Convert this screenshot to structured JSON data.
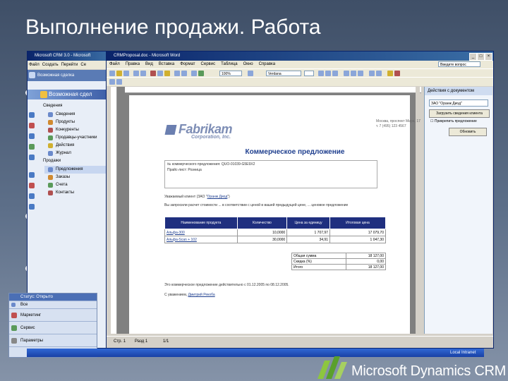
{
  "slide": {
    "title": "Выполнение продажи. Работа",
    "brand": "Microsoft Dynamics CRM"
  },
  "crm_window": {
    "title": "Microsoft CRM 3.0 - Microsoft",
    "menu": [
      "Файл",
      "Создать",
      "Перейти",
      "Се"
    ],
    "entity_header": "Возможная сделка",
    "header_strip": "Возможная сдел",
    "nav_group_details": "Сведения",
    "nav_details": [
      "Сведения",
      "Продукты",
      "Конкуренты",
      "Продавцы-участники",
      "Действия",
      "Журнал"
    ],
    "nav_group_sales": "Продажи",
    "nav_sales": [
      "Предложения",
      "Заказы",
      "Счета",
      "Контакты"
    ],
    "status": "Статус: Открыто",
    "bottom_nav": [
      "Все",
      "Маркетинг",
      "Сервис",
      "Параметры"
    ]
  },
  "word_window": {
    "title": "CRMProposal.doc - Microsoft Word",
    "menu": [
      "Файл",
      "Правка",
      "Вид",
      "Вставка",
      "Формат",
      "Сервис",
      "Таблица",
      "Окно",
      "Справка"
    ],
    "help_box": "Введите вопрос",
    "zoom": "100%",
    "font": "Verdana",
    "status": {
      "page": "Стр. 1",
      "section": "Разд 1",
      "pages": "1/1"
    }
  },
  "document": {
    "company": "Fabrikam",
    "company_sub": "Corporation, Inc.",
    "address": "Москва, проспект Мира, 17 т. 7 (495) 123 4567",
    "heading": "Коммерческое предложение",
    "quote_no_label": "№ коммерческого предложения:",
    "quote_no": "QUO-01039-G5E9X2",
    "price_list_label": "Прайс-лист:",
    "price_list": "Розница",
    "greeting_prefix": "Уважаемый клиент (ЗАО \"",
    "greeting_link": "Оранж Диод",
    "greeting_suffix": "\")",
    "intro": "Вы запросили расчет стоимости ... в соответствии с ценой в вашей предыдущей цене, ... ценовое предложение",
    "table_headers": [
      "Наименование продукта",
      "Количество",
      "Цена за единицу",
      "Итоговая цена"
    ],
    "rows": [
      {
        "product": "Альфа-300",
        "qty": "10,0000",
        "price": "1 707,97",
        "total": "17 079,70"
      },
      {
        "product": "Альфа-Scan + 102",
        "qty": "30,0000",
        "price": "34,91",
        "total": "1 047,30"
      }
    ],
    "totals": [
      {
        "label": "Общая сумма",
        "value": "18 127,00"
      },
      {
        "label": "Скидка (%)",
        "value": "0,00"
      },
      {
        "label": "Итого",
        "value": "18 127,00"
      }
    ],
    "validity": "Это коммерческое предложение действительно с 01.12.2005 по 08.12.2005.",
    "regards_prefix": "С уважением,",
    "regards_name": "Дмитрий Рекоба"
  },
  "task_pane": {
    "title": "Действия с документом",
    "combo": "ЗАО \"Оранж Диод\"",
    "button1": "Загрузить сведения клиента",
    "checkbox": "Прикрепить предложение",
    "button2": "Обновить"
  },
  "taskbar": {
    "local": "Local Intranet"
  },
  "colors": {
    "background": "#5d6f89",
    "table_header": "#1f2f7f",
    "doc_heading": "#1f3f8f",
    "brand_green": "#8dc63f"
  }
}
